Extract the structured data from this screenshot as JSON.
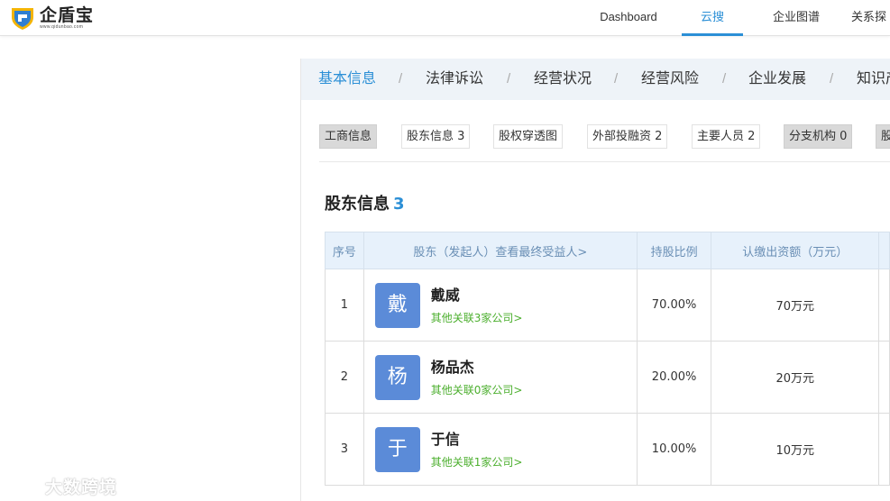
{
  "brand": {
    "name": "企盾宝",
    "domain": "www.qidunbao.com",
    "colors": {
      "shield_blue": "#2f7fd1",
      "shield_yellow": "#f4b400",
      "accent": "#2b8fd6",
      "link_green": "#4caf2e",
      "avatar": "#5b8bd8"
    }
  },
  "nav": {
    "items": [
      {
        "label": "Dashboard",
        "active": false
      },
      {
        "label": "云搜",
        "active": true
      },
      {
        "label": "企业图谱",
        "active": false
      },
      {
        "label": "关系探",
        "active": false
      }
    ]
  },
  "section_tabs": [
    {
      "label": "基本信息",
      "active": true
    },
    {
      "label": "法律诉讼",
      "active": false
    },
    {
      "label": "经营状况",
      "active": false
    },
    {
      "label": "经营风险",
      "active": false
    },
    {
      "label": "企业发展",
      "active": false
    },
    {
      "label": "知识产",
      "active": false
    }
  ],
  "section_separator": "/",
  "chips": [
    {
      "label": "工商信息",
      "style": "gray"
    },
    {
      "label": "股东信息 3",
      "style": "white"
    },
    {
      "label": "股权穿透图",
      "style": "white"
    },
    {
      "label": "外部投融资 2",
      "style": "white"
    },
    {
      "label": "主要人员 2",
      "style": "white"
    },
    {
      "label": "分支机构 0",
      "style": "gray"
    },
    {
      "label": "股",
      "style": "gray"
    }
  ],
  "shareholders": {
    "title": "股东信息",
    "count": "3",
    "columns": [
      "序号",
      "股东（发起人）查看最终受益人>",
      "持股比例",
      "认缴出资额（万元）"
    ],
    "rows": [
      {
        "index": "1",
        "avatar_char": "戴",
        "name": "戴威",
        "link": "其他关联3家公司>",
        "ratio": "70.00%",
        "capital": "70万元"
      },
      {
        "index": "2",
        "avatar_char": "杨",
        "name": "杨品杰",
        "link": "其他关联0家公司>",
        "ratio": "20.00%",
        "capital": "20万元"
      },
      {
        "index": "3",
        "avatar_char": "于",
        "name": "于信",
        "link": "其他关联1家公司>",
        "ratio": "10.00%",
        "capital": "10万元"
      }
    ]
  },
  "watermark": {
    "icon": "chat-bubble-icon",
    "text": "大数跨境"
  }
}
